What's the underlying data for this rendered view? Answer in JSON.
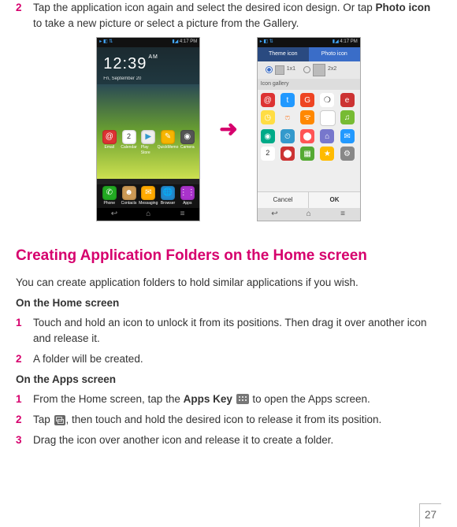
{
  "step_top": {
    "num": "2",
    "text_a": "Tap the application icon again and select the desired icon design. Or tap ",
    "text_bold": "Photo icon",
    "text_b": " to take a new picture or select a picture from the Gallery."
  },
  "phone1": {
    "status_time": "4:17 PM",
    "clock": "12:39",
    "ampm": "AM",
    "date": "Fri, September 20",
    "mid_icons": [
      "Email",
      "Calendar",
      "Play Store",
      "QuickMemo",
      "Camera"
    ],
    "dock": [
      "Phone",
      "Contacts",
      "Messaging",
      "Browser",
      "Apps"
    ]
  },
  "arrow": "➜",
  "phone2": {
    "status_time": "4:17 PM",
    "tab_theme": "Theme icon",
    "tab_photo": "Photo icon",
    "opt1": "1x1",
    "opt2": "2x2",
    "section": "Icon gallery",
    "cancel": "Cancel",
    "ok": "OK"
  },
  "heading": "Creating Application Folders on the Home screen",
  "intro": "You can create application folders to hold similar applications if you wish.",
  "home_head": "On the Home screen",
  "home_steps": [
    {
      "n": "1",
      "t": "Touch and hold an icon to unlock it from its positions. Then drag it over another icon and release it."
    },
    {
      "n": "2",
      "t": "A folder will be created."
    }
  ],
  "apps_head": "On the Apps screen",
  "apps_steps": [
    {
      "n": "1",
      "pre": "From the Home screen, tap the ",
      "bold": "Apps Key ",
      "post": " to open the Apps screen."
    },
    {
      "n": "2",
      "pre": "Tap ",
      "post": ", then touch and hold the desired icon to release it from its position."
    },
    {
      "n": "3",
      "pre": "Drag the icon over another icon and release it to create a folder."
    }
  ],
  "page": "27"
}
